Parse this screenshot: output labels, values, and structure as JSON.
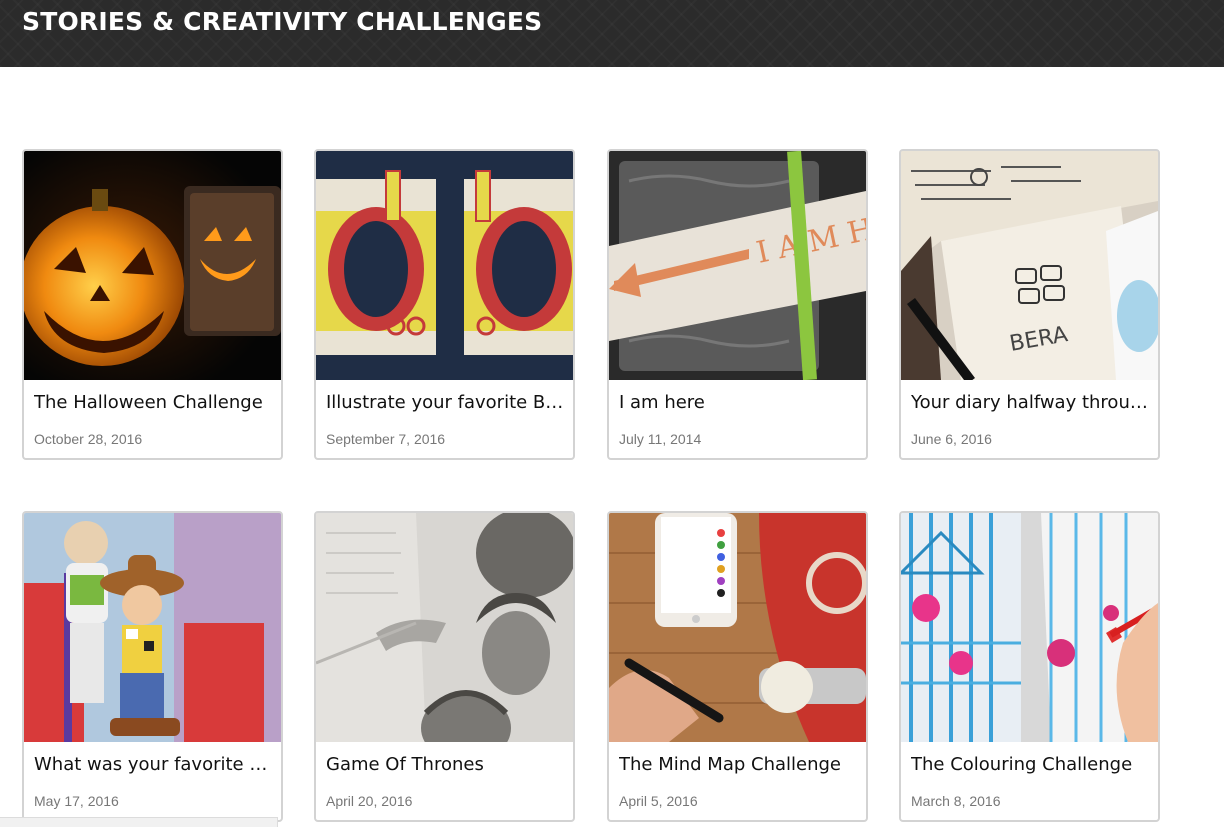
{
  "header": {
    "title": "STORIES & CREATIVITY CHALLENGES"
  },
  "cards": [
    {
      "title": "The Halloween Challenge",
      "date": "October 28, 2016",
      "image": "halloween-pumpkin-image"
    },
    {
      "title": "Illustrate your favorite Bea...",
      "date": "September 7, 2016",
      "image": "yellow-submarine-notebooks-image"
    },
    {
      "title": "I am here",
      "date": "July 11, 2014",
      "image": "i-am-here-notebook-image"
    },
    {
      "title": "Your diary halfway through...",
      "date": "June 6, 2016",
      "image": "diary-sketch-image"
    },
    {
      "title": "What was your favorite toy ...",
      "date": "May 17, 2016",
      "image": "toy-story-figures-image"
    },
    {
      "title": "Game Of Thrones",
      "date": "April 20, 2016",
      "image": "game-of-thrones-drawing-image"
    },
    {
      "title": "The Mind Map Challenge",
      "date": "April 5, 2016",
      "image": "mind-map-phone-image"
    },
    {
      "title": "The Colouring Challenge",
      "date": "March 8, 2016",
      "image": "colouring-book-image"
    }
  ],
  "colors": {
    "header_bg": "#2b2b2b",
    "card_border": "#d3d3d3",
    "date_text": "#777777"
  }
}
